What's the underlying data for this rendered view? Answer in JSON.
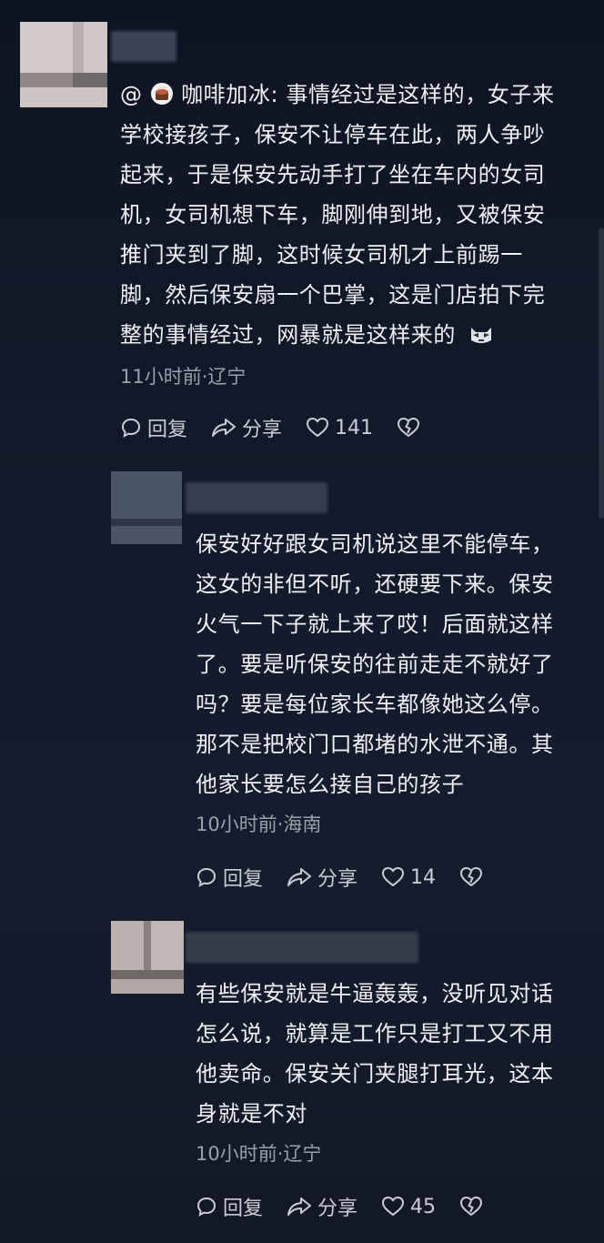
{
  "comments": [
    {
      "mention_prefix": "@",
      "mention_name": "咖啡加冰:",
      "text_lines": [
        " 事情经过是这样的，女子来",
        "学校接孩子，保安不让停车在此，两人争吵",
        "起来，于是保安先动手打了坐在车内的女司",
        "机，女司机想下车，脚刚伸到地，又被保安",
        "推门夹到了脚，这时候女司机才上前踢一",
        "脚，然后保安扇一个巴掌，这是门店拍下完",
        "整的事情经过，网暴就是这样来的"
      ],
      "meta": "11小时前·辽宁",
      "reply_label": "回复",
      "share_label": "分享",
      "likes": "141"
    },
    {
      "text_lines": [
        "保安好好跟女司机说这里不能停车，",
        "这女的非但不听，还硬要下来。保安",
        "火气一下子就上来了哎！后面就这样",
        "了。要是听保安的往前走走不就好了",
        "吗？要是每位家长车都像她这么停。",
        "那不是把校门口都堵的水泄不通。其",
        "他家长要怎么接自己的孩子"
      ],
      "meta": "10小时前·海南",
      "reply_label": "回复",
      "share_label": "分享",
      "likes": "14"
    },
    {
      "text_lines": [
        "有些保安就是牛逼轰轰，没听见对话",
        "怎么说，就算是工作只是打工又不用",
        "他卖命。保安关门夹腿打耳光，这本",
        "身就是不对"
      ],
      "meta": "10小时前·辽宁",
      "reply_label": "回复",
      "share_label": "分享",
      "likes": "45"
    }
  ],
  "icons": {
    "reply": "speech-bubble-icon",
    "share": "share-arrow-icon",
    "like": "heart-icon",
    "dislike": "broken-heart-icon",
    "mention_emoji": "cake-cup-emoji",
    "end_emoji": "cat-face-emoji"
  }
}
